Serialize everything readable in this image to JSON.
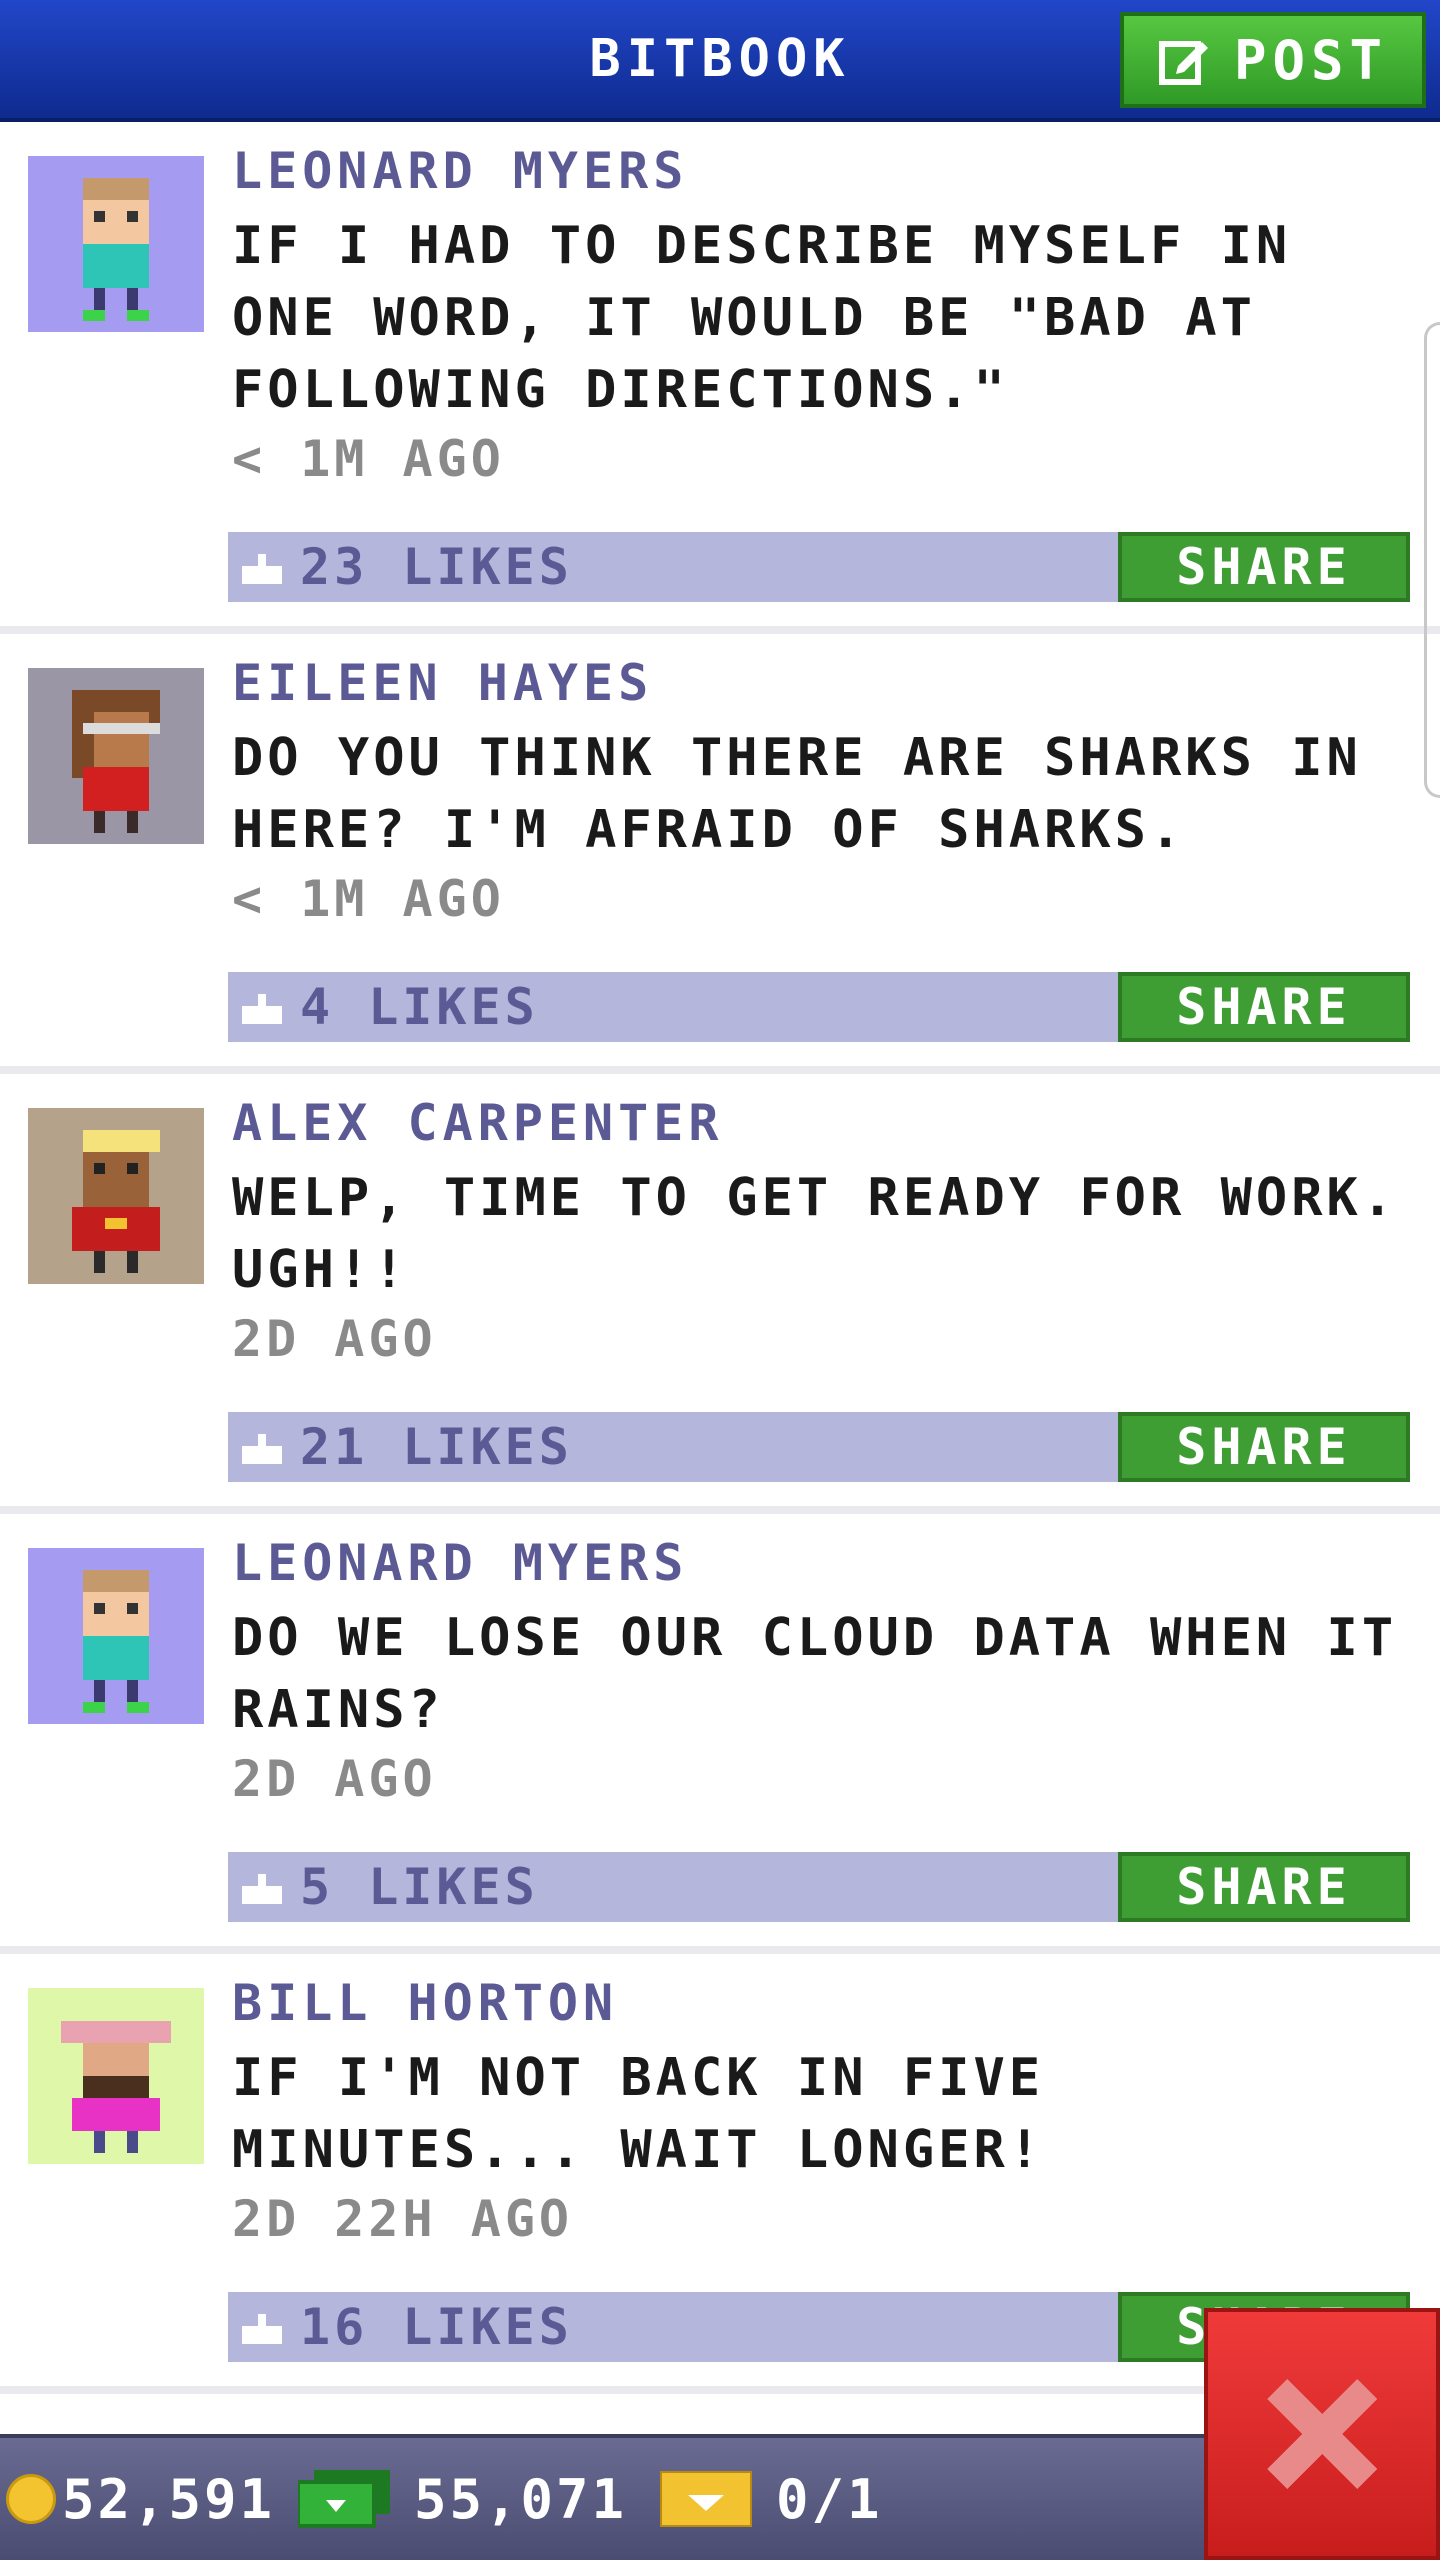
{
  "header": {
    "title": "BITBOOK",
    "post_label": "POST"
  },
  "posts": [
    {
      "author": "LEONARD MYERS",
      "text": "IF I HAD TO DESCRIBE MYSELF IN ONE WORD, IT WOULD BE \"BAD AT FOLLOWING DIRECTIONS.\"",
      "time": "< 1M AGO",
      "likes": "23 LIKES",
      "share": "SHARE",
      "avatar_bg": "#a59cf2"
    },
    {
      "author": "EILEEN HAYES",
      "text": "DO YOU THINK THERE ARE SHARKS IN HERE? I'M AFRAID OF SHARKS.",
      "time": "< 1M AGO",
      "likes": "4 LIKES",
      "share": "SHARE",
      "avatar_bg": "#9a96a6"
    },
    {
      "author": "ALEX CARPENTER",
      "text": "WELP, TIME TO GET READY FOR WORK. UGH!!",
      "time": "2D AGO",
      "likes": "21 LIKES",
      "share": "SHARE",
      "avatar_bg": "#b4a28a"
    },
    {
      "author": "LEONARD MYERS",
      "text": "DO WE LOSE OUR CLOUD DATA WHEN IT RAINS?",
      "time": "2D AGO",
      "likes": "5 LIKES",
      "share": "SHARE",
      "avatar_bg": "#a59cf2"
    },
    {
      "author": "BILL HORTON",
      "text": "IF I'M NOT BACK IN FIVE MINUTES... WAIT LONGER!",
      "time": "2D 22H AGO",
      "likes": "16 LIKES",
      "share": "SHARE",
      "avatar_bg": "#def7a8"
    }
  ],
  "status": {
    "coins": "52,591",
    "bux": "55,071",
    "tickets": "0/1"
  }
}
